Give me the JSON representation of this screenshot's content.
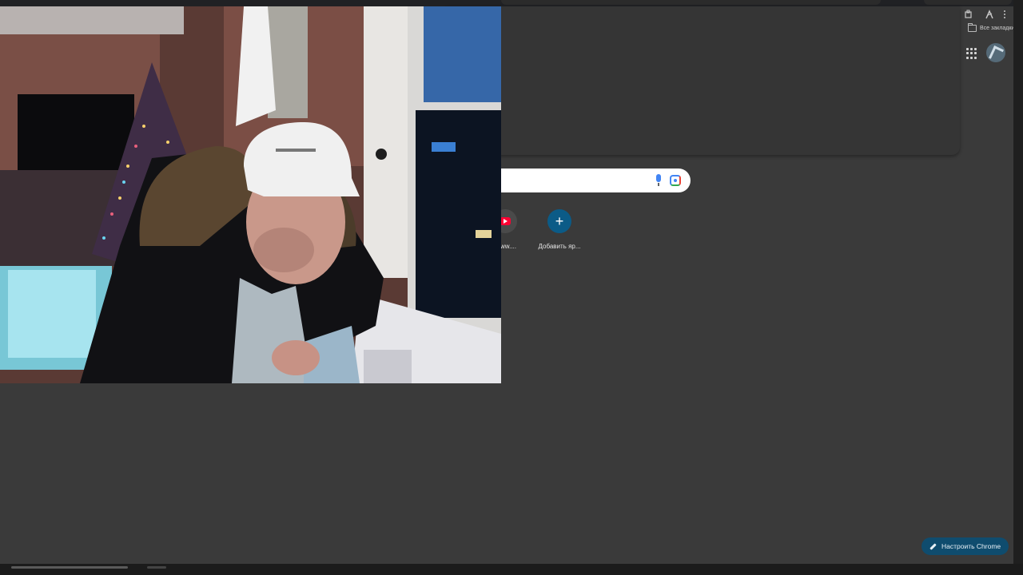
{
  "toolbar": {
    "bookmarks_label": "Все закладки"
  },
  "shortcuts": [
    {
      "label": "/www....",
      "icon": "youtube-icon"
    },
    {
      "label": "Добавить яр...",
      "icon": "plus-icon"
    }
  ],
  "add_shortcut_symbol": "+",
  "customize": {
    "label": "Настроить Chrome",
    "icon": "pencil-icon"
  },
  "colors": {
    "page_bg": "#3a3a3a",
    "customize_bg": "#0f4c6e",
    "add_shortcut_bg": "#0b5b87",
    "search_bg": "#ffffff"
  }
}
